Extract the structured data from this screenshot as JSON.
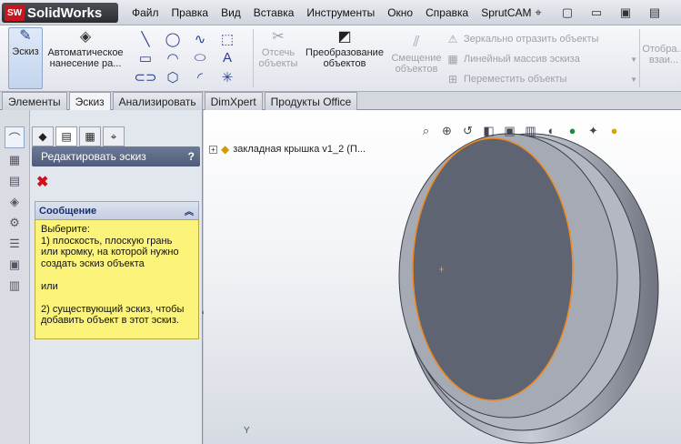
{
  "app": {
    "name": "SolidWorks",
    "logo_mark": "SW"
  },
  "menu": [
    "Файл",
    "Правка",
    "Вид",
    "Вставка",
    "Инструменты",
    "Окно",
    "Справка",
    "SprutCAM"
  ],
  "quickbar": [
    {
      "icon": "pin-icon",
      "glyph": "⌖"
    },
    {
      "icon": "new-document-icon",
      "glyph": "▢"
    },
    {
      "icon": "open-folder-icon",
      "glyph": "▭"
    },
    {
      "icon": "save-icon",
      "glyph": "▣"
    },
    {
      "icon": "print-icon",
      "glyph": "▤"
    }
  ],
  "ribbon": {
    "sketch": "Эскиз",
    "smart_dimension": "Автоматическое нанесение ра...",
    "trim": "Отсечь объекты",
    "convert": "Преобразование объектов",
    "offset": "Смещение объектов",
    "mirror": "Зеркально отразить объекты",
    "linear_pattern": "Линейный массив эскиза",
    "move": "Переместить объекты",
    "display": "Отобра... взаи..."
  },
  "tabs": [
    "Элементы",
    "Эскиз",
    "Анализировать",
    "DimXpert",
    "Продукты Office"
  ],
  "active_tab": "Эскиз",
  "panel": {
    "title": "Редактировать эскиз",
    "help": "?",
    "cancel_glyph": "✖",
    "message_title": "Сообщение",
    "message_body": "Выберите:\n1) плоскость, плоскую грань\nили кромку, на которой нужно\nсоздать эскиз объекта\n\nили\n\n2) существующий эскиз, чтобы\nдобавить объект в этот эскиз."
  },
  "tree": {
    "item_label": "закладная крышка v1_2  (П..."
  },
  "axis": {
    "y_label": "Y"
  },
  "colors": {
    "accent": "#4f5b78",
    "highlight": "#f08a1c",
    "message_bg": "#fcf37a",
    "model_face": "#5f6472"
  }
}
